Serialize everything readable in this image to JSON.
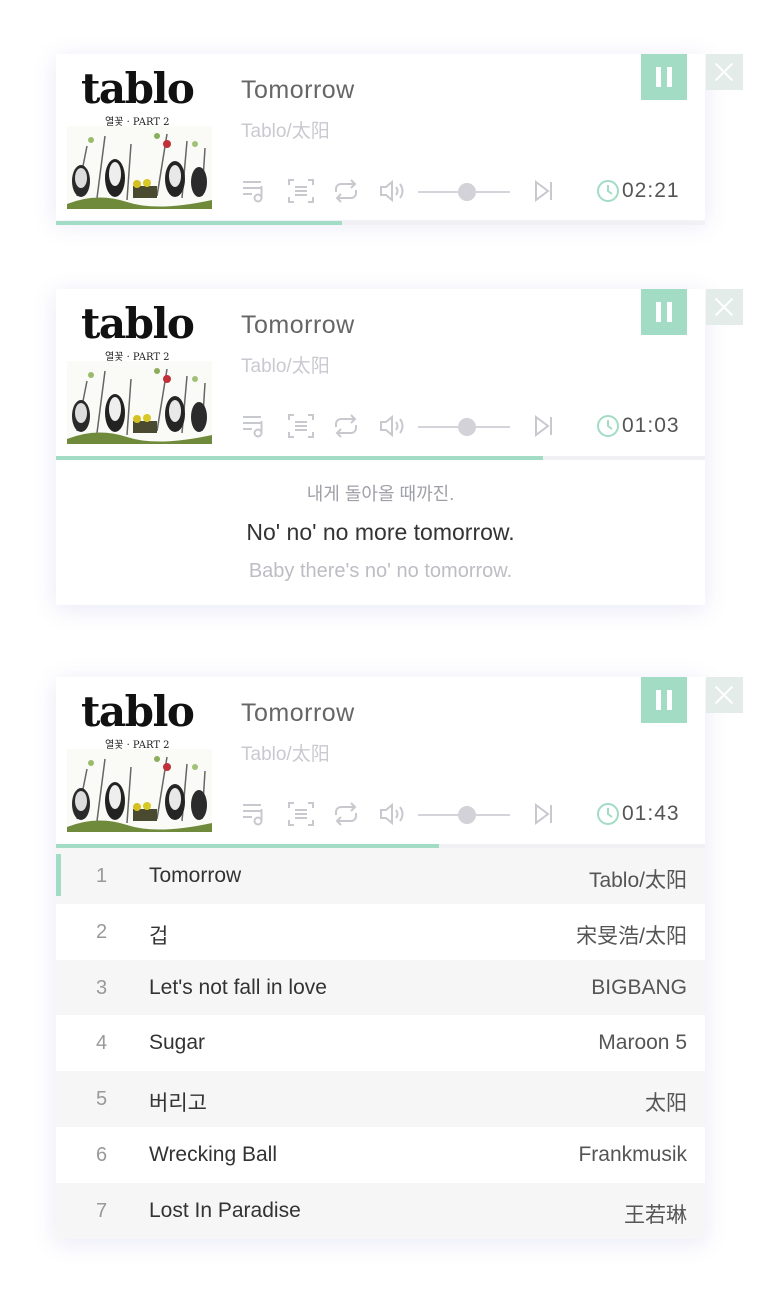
{
  "colors": {
    "accent": "#a2dcc5",
    "close_bg": "#e3ece8",
    "muted": "#c9c9d0"
  },
  "album": {
    "logo": "tablo",
    "subtitle": "열꽃 · PART 2"
  },
  "icons": [
    "playlist-icon",
    "lyrics-icon",
    "loop-icon",
    "volume-icon",
    "next-icon",
    "clock-icon",
    "pause-icon",
    "close-icon"
  ],
  "players": [
    {
      "title": "Tomorrow",
      "artist": "Tablo/太阳",
      "time": "02:21",
      "progress": 0.44,
      "volume": 0.5
    },
    {
      "title": "Tomorrow",
      "artist": "Tablo/太阳",
      "time": "01:03",
      "progress": 0.75,
      "volume": 0.5
    },
    {
      "title": "Tomorrow",
      "artist": "Tablo/太阳",
      "time": "01:43",
      "progress": 0.59,
      "volume": 0.5
    }
  ],
  "lyrics": {
    "previous": "내게 돌아올 때까진.",
    "current": "No' no' no more tomorrow.",
    "next": "Baby there's no' no tomorrow."
  },
  "playlist": [
    {
      "num": "1",
      "song": "Tomorrow",
      "artist": "Tablo/太阳",
      "active": true
    },
    {
      "num": "2",
      "song": "겁",
      "artist": "宋旻浩/太阳"
    },
    {
      "num": "3",
      "song": "Let's not fall in love",
      "artist": "BIGBANG"
    },
    {
      "num": "4",
      "song": "Sugar",
      "artist": "Maroon 5"
    },
    {
      "num": "5",
      "song": "버리고",
      "artist": "太阳"
    },
    {
      "num": "6",
      "song": "Wrecking Ball",
      "artist": "Frankmusik"
    },
    {
      "num": "7",
      "song": "Lost In Paradise",
      "artist": "王若琳"
    }
  ]
}
